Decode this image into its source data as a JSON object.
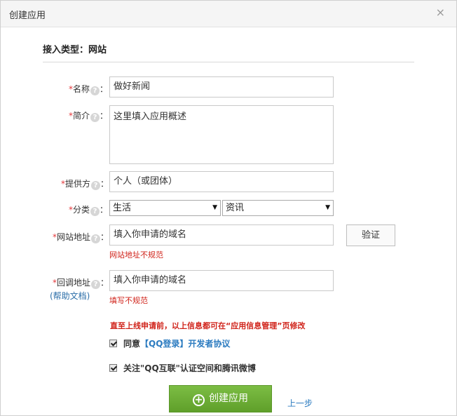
{
  "dialog": {
    "title": "创建应用",
    "close_icon": "×"
  },
  "section": {
    "title": "接入类型：网站"
  },
  "colors": {
    "required": "#e4393c",
    "error": "#d0231a",
    "link": "#2b7bc0",
    "primary_button": "#6fae36"
  },
  "form": {
    "name": {
      "required": "*",
      "label": "名称",
      "help": "?",
      "colon": "：",
      "value": "做好新闻"
    },
    "intro": {
      "required": "*",
      "label": "简介",
      "help": "?",
      "colon": "：",
      "value": "这里填入应用概述"
    },
    "provider": {
      "required": "*",
      "label": "提供方",
      "help": "?",
      "colon": "：",
      "value": "个人（或团体）"
    },
    "category": {
      "required": "*",
      "label": "分类",
      "help": "?",
      "colon": "：",
      "primary": "生活",
      "secondary": "资讯",
      "arrow": "▼"
    },
    "website": {
      "required": "*",
      "label": "网站地址",
      "help": "?",
      "colon": "：",
      "value": "填入你申请的域名",
      "error": "网站地址不规范",
      "verify_label": "验证"
    },
    "callback": {
      "required": "*",
      "label": "回调地址",
      "help": "?",
      "colon": "：",
      "value": "填入你申请的域名",
      "error": "填写不规范",
      "help_doc": "(帮助文档)"
    }
  },
  "notice": "直至上线申请前，以上信息都可在“应用信息管理”页修改",
  "agreements": {
    "agree_prefix": "同意",
    "agree_link": "【QQ登录】开发者协议",
    "follow": "关注\"QQ互联\"认证空间和腾讯微博"
  },
  "actions": {
    "create_icon": "+",
    "create_label": "创建应用",
    "prev_label": "上一步"
  }
}
